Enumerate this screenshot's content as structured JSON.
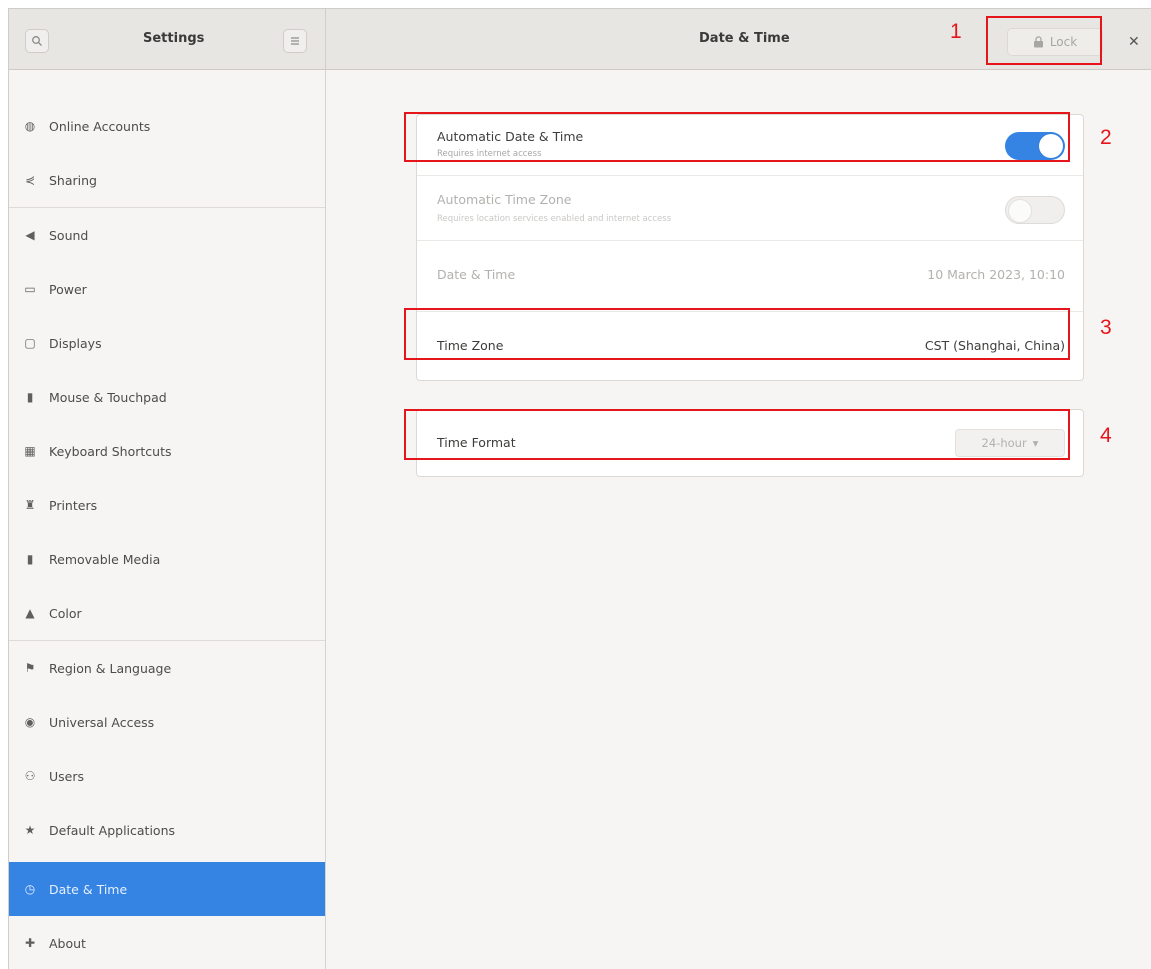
{
  "header": {
    "app_title": "Settings",
    "page_title": "Date & Time",
    "lock_label": "Lock",
    "search_icon": "search-icon",
    "menu_icon": "hamburger-menu-icon",
    "close_icon": "close-icon"
  },
  "sidebar": {
    "items": [
      {
        "label": "Online Accounts",
        "icon": "globe-icon"
      },
      {
        "label": "Sharing",
        "icon": "share-icon"
      },
      {
        "label": "Sound",
        "icon": "speaker-icon"
      },
      {
        "label": "Power",
        "icon": "battery-icon"
      },
      {
        "label": "Displays",
        "icon": "monitor-icon"
      },
      {
        "label": "Mouse & Touchpad",
        "icon": "mouse-icon"
      },
      {
        "label": "Keyboard Shortcuts",
        "icon": "keyboard-icon"
      },
      {
        "label": "Printers",
        "icon": "printer-icon"
      },
      {
        "label": "Removable Media",
        "icon": "usb-icon"
      },
      {
        "label": "Color",
        "icon": "color-icon"
      },
      {
        "label": "Region & Language",
        "icon": "flag-icon"
      },
      {
        "label": "Universal Access",
        "icon": "accessibility-icon"
      },
      {
        "label": "Users",
        "icon": "users-icon"
      },
      {
        "label": "Default Applications",
        "icon": "star-icon"
      },
      {
        "label": "Date & Time",
        "icon": "clock-icon",
        "active": true
      },
      {
        "label": "About",
        "icon": "info-icon"
      }
    ]
  },
  "content": {
    "auto_datetime": {
      "label": "Automatic Date & Time",
      "sub": "Requires internet access",
      "enabled": true
    },
    "auto_timezone": {
      "label": "Automatic Time Zone",
      "sub": "Requires location services enabled and internet access",
      "enabled": false
    },
    "datetime": {
      "label": "Date & Time",
      "value": "10 March 2023, 10:10"
    },
    "timezone": {
      "label": "Time Zone",
      "value": "CST (Shanghai, China)"
    },
    "time_format": {
      "label": "Time Format",
      "value": "24-hour"
    }
  },
  "annotations": [
    "1",
    "2",
    "3",
    "4"
  ],
  "colors": {
    "accent": "#3584e4",
    "annotation": "#e4161b"
  }
}
